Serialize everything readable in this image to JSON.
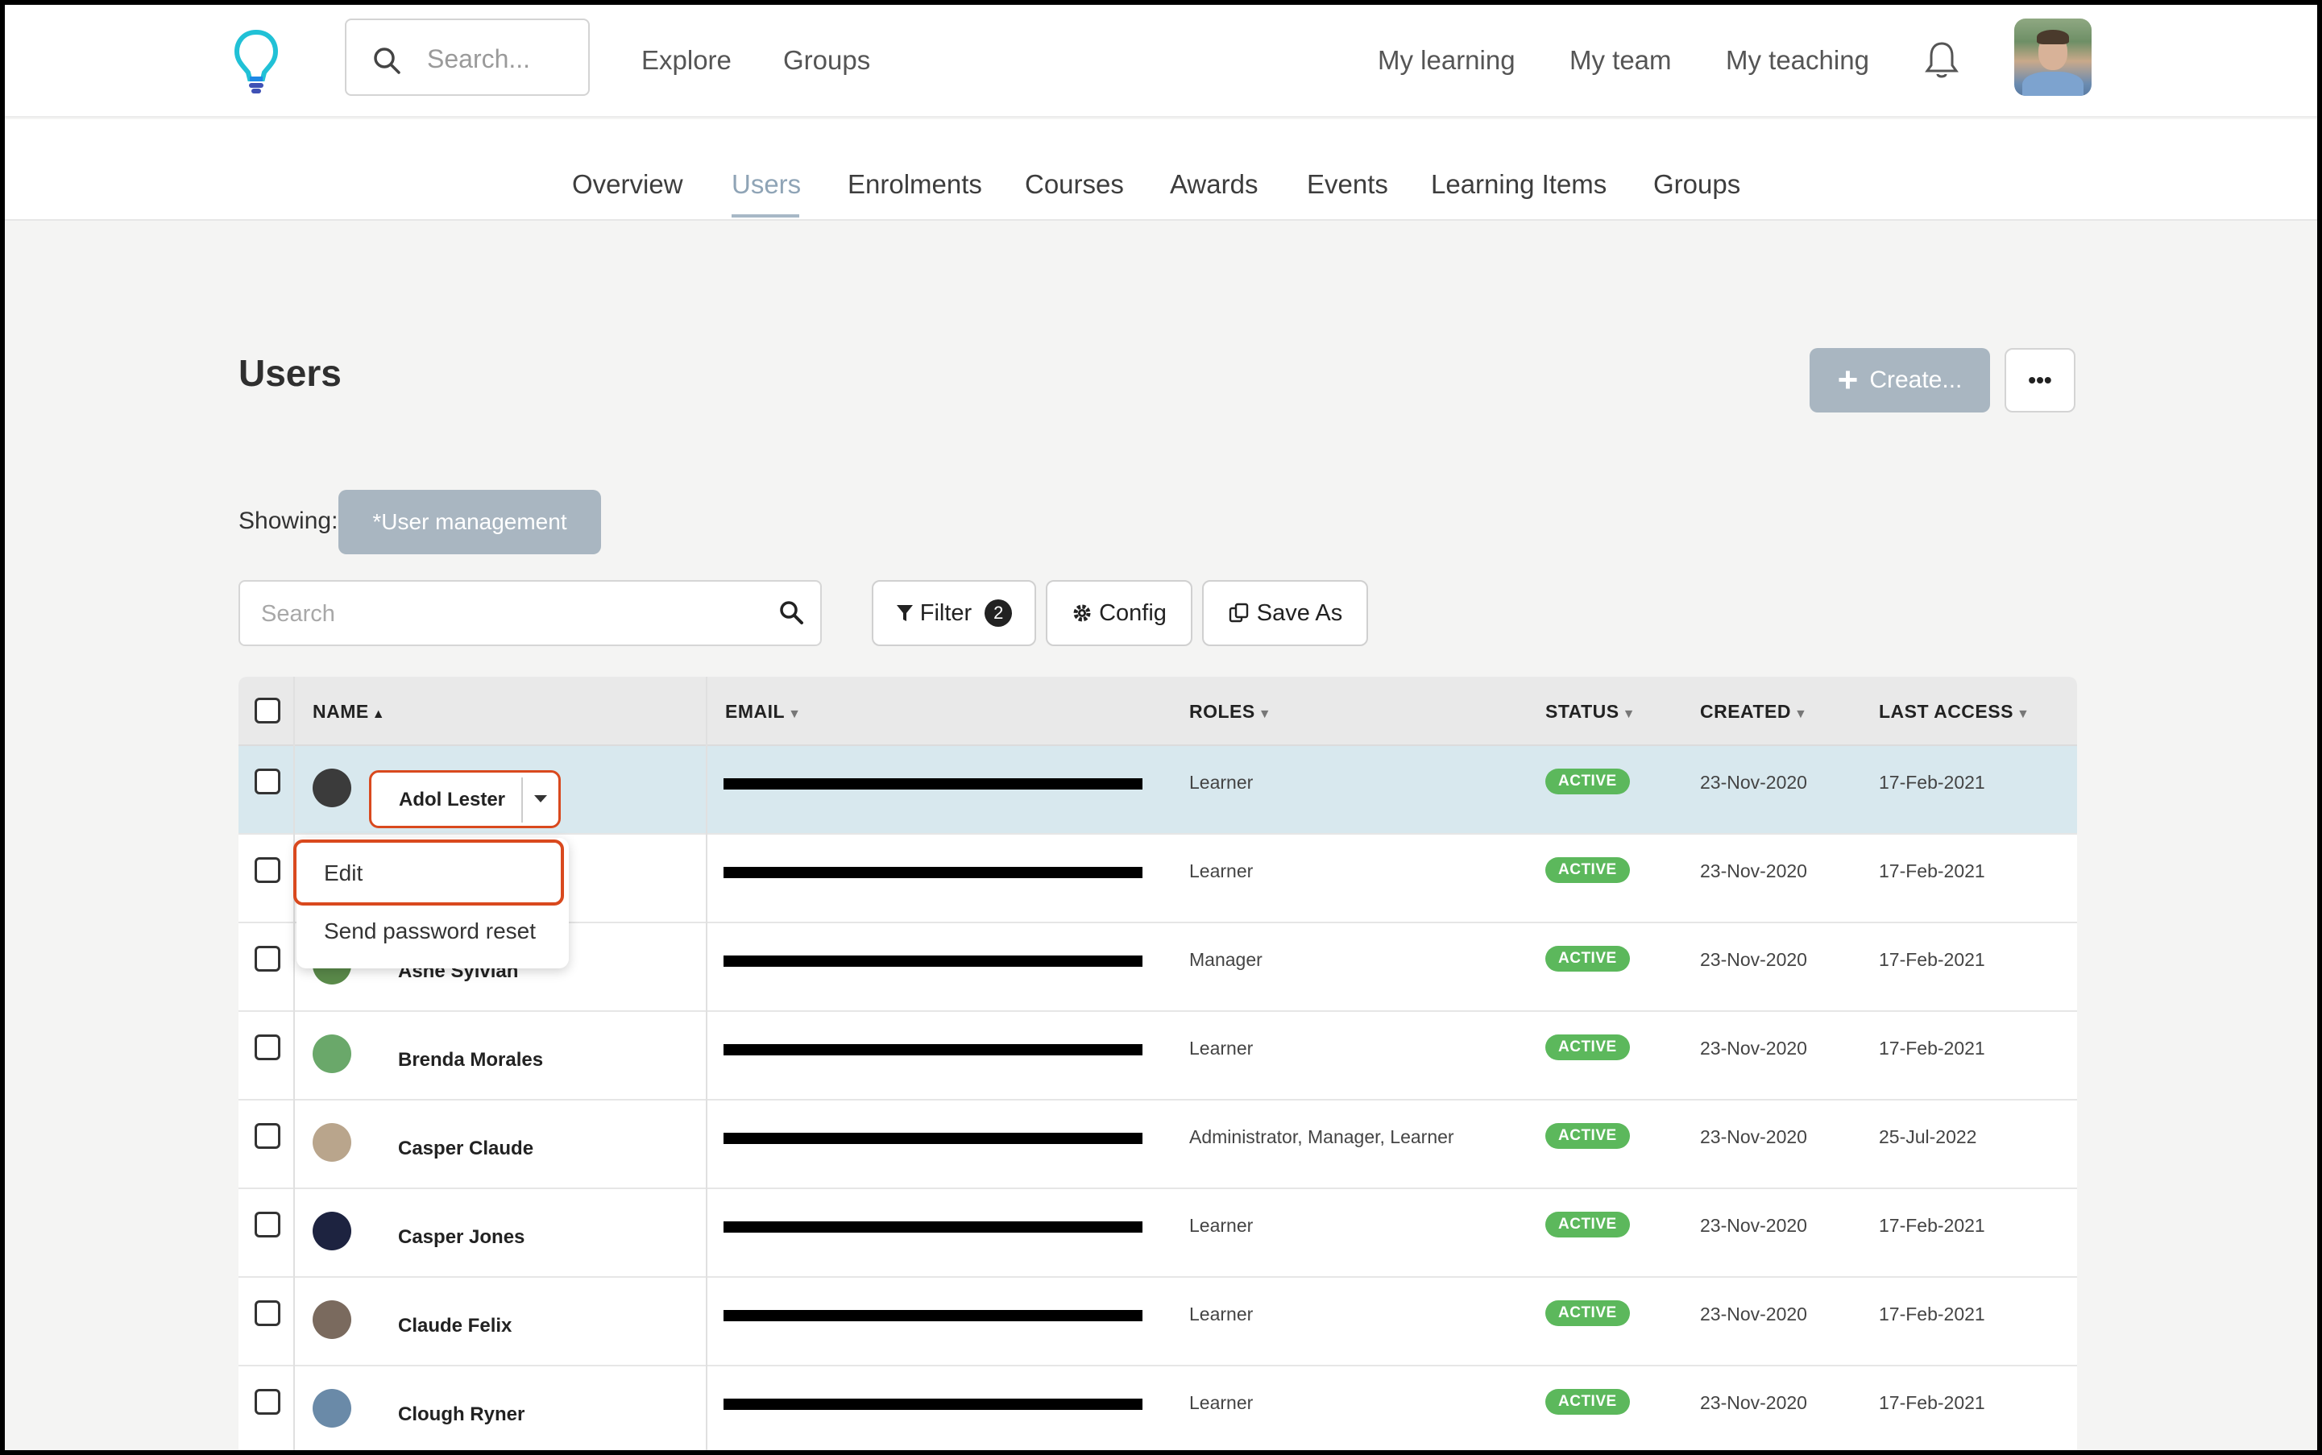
{
  "header": {
    "search_placeholder": "Search...",
    "nav_left": [
      "Explore",
      "Groups"
    ],
    "nav_right": [
      "My learning",
      "My team",
      "My teaching"
    ]
  },
  "subnav": {
    "tabs": [
      "Overview",
      "Users",
      "Enrolments",
      "Courses",
      "Awards",
      "Events",
      "Learning Items",
      "Groups"
    ],
    "active": "Users"
  },
  "page": {
    "title": "Users",
    "create_label": "Create...",
    "more_label": "•••",
    "showing_label": "Showing:",
    "showing_value": "*User management",
    "search_placeholder": "Search",
    "filter_label": "Filter",
    "filter_count": "2",
    "config_label": "Config",
    "save_as_label": "Save As"
  },
  "table": {
    "headers": {
      "name": "NAME",
      "email": "EMAIL",
      "roles": "ROLES",
      "status": "STATUS",
      "created": "CREATED",
      "last_access": "LAST ACCESS"
    },
    "rows": [
      {
        "name": "Adol Lester",
        "role": "Learner",
        "status": "ACTIVE",
        "created": "23-Nov-2020",
        "last_access": "17-Feb-2021",
        "avatar_color": "#3b3b3b"
      },
      {
        "name": "",
        "role": "Learner",
        "status": "ACTIVE",
        "created": "23-Nov-2020",
        "last_access": "17-Feb-2021",
        "avatar_color": "#777777"
      },
      {
        "name": "Ashe Sylvian",
        "role": "Manager",
        "status": "ACTIVE",
        "created": "23-Nov-2020",
        "last_access": "17-Feb-2021",
        "avatar_color": "#5a8a4a"
      },
      {
        "name": "Brenda Morales",
        "role": "Learner",
        "status": "ACTIVE",
        "created": "23-Nov-2020",
        "last_access": "17-Feb-2021",
        "avatar_color": "#6aa86a"
      },
      {
        "name": "Casper Claude",
        "role": "Administrator, Manager, Learner",
        "status": "ACTIVE",
        "created": "23-Nov-2020",
        "last_access": "25-Jul-2022",
        "avatar_color": "#b9a58c"
      },
      {
        "name": "Casper Jones",
        "role": "Learner",
        "status": "ACTIVE",
        "created": "23-Nov-2020",
        "last_access": "17-Feb-2021",
        "avatar_color": "#1d2340"
      },
      {
        "name": "Claude Felix",
        "role": "Learner",
        "status": "ACTIVE",
        "created": "23-Nov-2020",
        "last_access": "17-Feb-2021",
        "avatar_color": "#7a6a5e"
      },
      {
        "name": "Clough Ryner",
        "role": "Learner",
        "status": "ACTIVE",
        "created": "23-Nov-2020",
        "last_access": "17-Feb-2021",
        "avatar_color": "#6a8aa8"
      }
    ]
  },
  "menu": {
    "items": [
      "Edit",
      "Send password reset"
    ]
  },
  "colors": {
    "accent_highlight": "#d9491e",
    "status_active": "#5cb85c",
    "chip_bg": "#a9b6c1",
    "row_selected": "#d8e8ee",
    "logo_blue": "#1e88e5",
    "logo_cyan": "#21c1d6"
  },
  "icons": [
    "lightbulb-logo-icon",
    "search-icon",
    "bell-icon",
    "filter-icon",
    "gear-icon",
    "copy-icon",
    "chevron-down-icon",
    "sort-arrow-icon"
  ]
}
